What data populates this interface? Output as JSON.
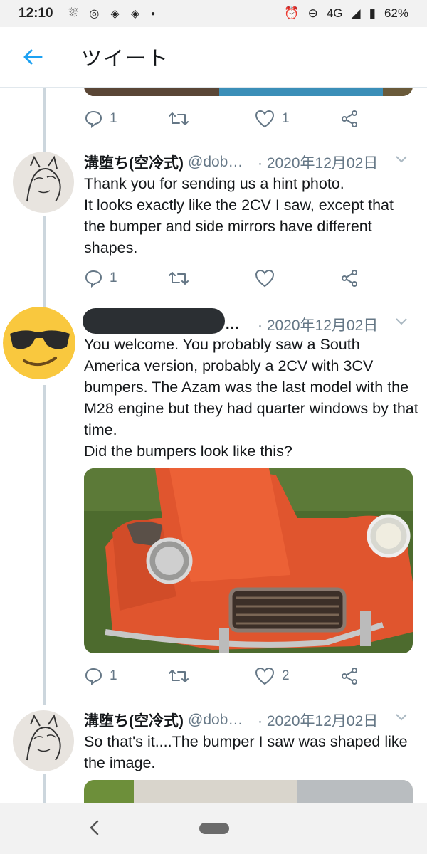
{
  "status": {
    "time": "12:10",
    "network": "4G",
    "battery": "62%"
  },
  "header": {
    "title": "ツイート"
  },
  "tweets": [
    {
      "replies": "1",
      "likes": "1"
    },
    {
      "name": "溝堕ち(空冷式)",
      "handle": "@dob…",
      "date": "· 2020年12月02日",
      "lines": [
        "Thank you for sending us a hint photo.",
        "It looks exactly like the 2CV I saw, except that the bumper and side mirrors have different shapes."
      ],
      "replies": "1",
      "likes": ""
    },
    {
      "name_suffix": "…",
      "date": "· 2020年12月02日",
      "lines": [
        "You welcome. You probably saw a South America version, probably a 2CV with 3CV bumpers. The Azam was the last model with the M28 engine but they had quarter windows by that time.",
        "Did the bumpers look like this?"
      ],
      "replies": "1",
      "likes": "2"
    },
    {
      "name": "溝堕ち(空冷式)",
      "handle": "@dob…",
      "date": "· 2020年12月02日",
      "lines": [
        "So that's it....The bumper I saw was shaped like the image."
      ]
    }
  ],
  "colors": {
    "accent": "#1da1f2",
    "muted": "#657786",
    "thread_line": "#ccd6dd"
  },
  "icons": [
    "back-arrow-icon",
    "reply-icon",
    "retweet-icon",
    "like-icon",
    "share-icon",
    "caret-down-icon"
  ]
}
